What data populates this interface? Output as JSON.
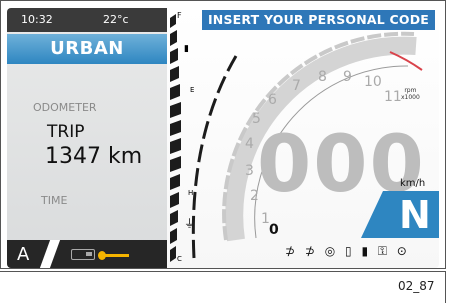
{
  "status_bar": {
    "time": "10:32",
    "temperature": "22°c"
  },
  "mode_title": "URBAN",
  "odometer_label": "ODOMETER",
  "trip_label": "TRIP",
  "trip_value": "1347 km",
  "time_label": "TIME",
  "riding_mode": "A",
  "header_message": "INSERT YOUR PERSONAL CODE",
  "fuel_scale": {
    "full": "F",
    "half": "E",
    "low": "H",
    "empty": "C"
  },
  "tachometer": {
    "ticks": [
      "1",
      "2",
      "3",
      "4",
      "5",
      "6",
      "7",
      "8",
      "9",
      "10",
      "11"
    ],
    "unit_line1": "rpm",
    "unit_line2": "x1000"
  },
  "speed": {
    "value": "000",
    "unit": "km/h"
  },
  "gear": "N",
  "zero_mark": "0",
  "indicators": [
    "headlight-icon",
    "high-beam-icon",
    "abs-icon",
    "fuel-reserve-icon",
    "battery-icon",
    "key-icon",
    "location-icon"
  ],
  "indicator_glyphs": "⊅ ⊅ ◎ ▯ ▮ ⚿ ⊙",
  "figure_code": "02_87",
  "colors": {
    "accent_blue": "#2e86c1",
    "header_blue": "#2e77b8",
    "warning_yellow": "#f5b400",
    "redline": "#d9434b"
  }
}
